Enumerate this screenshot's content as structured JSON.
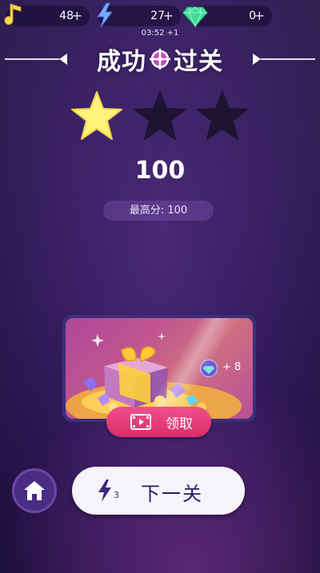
{
  "resources": {
    "notes": {
      "value": "48",
      "plus": "+",
      "icon": "music-note-icon"
    },
    "energy": {
      "value": "27",
      "plus": "+",
      "icon": "lightning-icon"
    },
    "gems": {
      "value": "0",
      "plus": "+",
      "icon": "diamond-icon"
    }
  },
  "timer": "03:52 +1",
  "title": {
    "left": "成功",
    "right": "过关",
    "icon": "crosshair-icon"
  },
  "stars": {
    "earned": 1,
    "total": 3
  },
  "score": "100",
  "best_score": "最高分: 100",
  "reward": {
    "amount": "+ 8",
    "icon": "diamond-icon",
    "image": "gift-box-with-gems"
  },
  "claim": {
    "label": "领取",
    "icon": "video-icon"
  },
  "home": {
    "icon": "home-icon"
  },
  "next": {
    "label": "下一关",
    "cost": "3",
    "icon": "lightning-icon"
  },
  "colors": {
    "background": "#3a1f66",
    "star_active": "#fff27a",
    "star_inactive": "#1d1433",
    "claim_button": "#e8407c",
    "next_button": "#f6f3fb",
    "energy": "#7aa8ff",
    "gem": "#3ddc9a"
  }
}
